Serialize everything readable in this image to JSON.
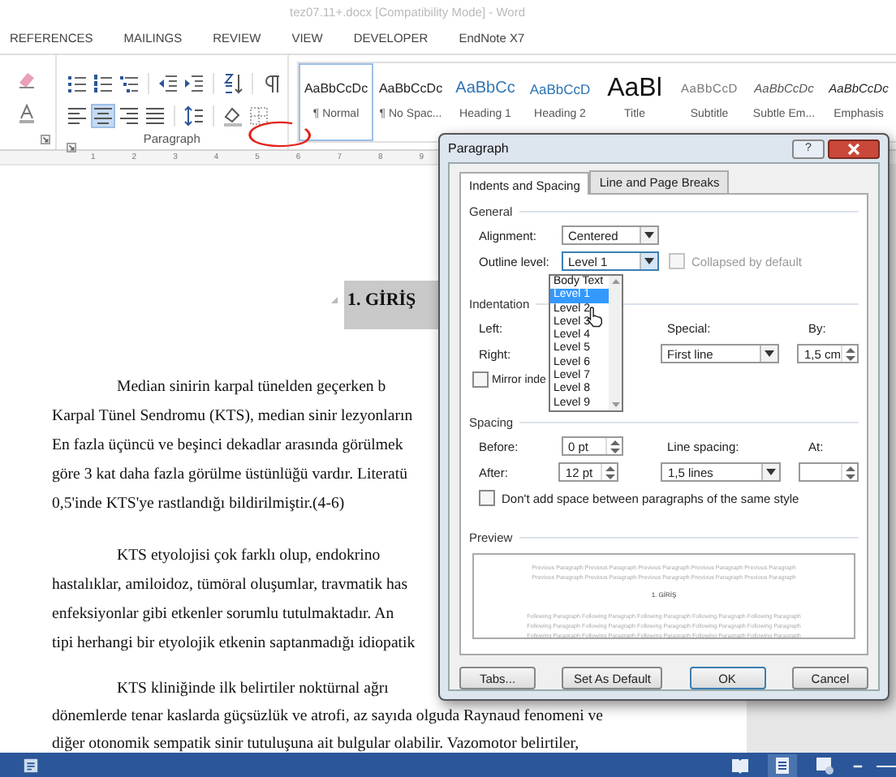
{
  "window": {
    "title": "tez07.11+.docx [Compatibility Mode] - Word"
  },
  "ribbon_tabs": [
    "REFERENCES",
    "MAILINGS",
    "REVIEW",
    "VIEW",
    "DEVELOPER",
    "EndNote X7"
  ],
  "ribbon": {
    "paragraph_group": {
      "label": "Paragraph",
      "alignments": [
        {
          "kind": "left",
          "selected": false
        },
        {
          "kind": "center",
          "selected": true
        },
        {
          "kind": "right",
          "selected": false
        },
        {
          "kind": "justify",
          "selected": false
        }
      ]
    },
    "styles": [
      {
        "kind": "normal",
        "preview": "AaBbCcDc",
        "name": "¶ Normal",
        "selected": true
      },
      {
        "kind": "nospacing",
        "preview": "AaBbCcDc",
        "name": "¶ No Spac...",
        "selected": false
      },
      {
        "kind": "heading1",
        "preview": "AaBbCc",
        "name": "Heading 1",
        "selected": false
      },
      {
        "kind": "heading2",
        "preview": "AaBbCcD",
        "name": "Heading 2",
        "selected": false
      },
      {
        "kind": "title",
        "preview": "AaBl",
        "name": "Title",
        "selected": false
      },
      {
        "kind": "subtitle",
        "preview": "AaBbCcD",
        "name": "Subtitle",
        "selected": false
      },
      {
        "kind": "subtle",
        "preview": "AaBbCcDc",
        "name": "Subtle Em...",
        "selected": false
      },
      {
        "kind": "emphasis",
        "preview": "AaBbCcDc",
        "name": "Emphasis",
        "selected": false
      }
    ]
  },
  "ruler": [
    "1",
    "2",
    "3",
    "4",
    "5",
    "6",
    "7",
    "8",
    "9"
  ],
  "document": {
    "heading": "1. GİRİŞ",
    "paragraphs": [
      {
        "lines": [
          "Median sinirin karpal tünelden geçerken b",
          "Karpal Tünel Sendromu (KTS), median sinir lezyonların",
          "En fazla üçüncü ve beşinci dekadlar arasında görülmek",
          "göre 3 kat daha fazla görülme üstünlüğü vardır. Literatü",
          "0,5'inde KTS'ye rastlandığı bildirilmiştir.(4-6)"
        ]
      },
      {
        "lines": [
          "KTS etyolojisi çok farklı olup, endokrino",
          "hastalıklar, amiloidoz, tümöral oluşumlar, travmatik has",
          "enfeksiyonlar gibi etkenler sorumlu tutulmaktadır.  An",
          "tipi herhangi bir etyolojik etkenin saptanmadığı idiopatik"
        ]
      },
      {
        "lines": [
          "KTS kliniğinde ilk belirtiler noktürnal ağrı",
          "dönemlerde tenar kaslarda güçsüzlük ve atrofi, az sayıda olguda Raynaud fenomeni ve",
          "diğer otonomik sempatik sinir tutuluşuna ait bulgular olabilir. Vazomotor belirtiler,"
        ]
      }
    ]
  },
  "dialog": {
    "title": "Paragraph",
    "help": "?",
    "tabs": [
      {
        "label": "Indents and Spacing",
        "selected": true
      },
      {
        "label": "Line and Page Breaks",
        "selected": false
      }
    ],
    "general": {
      "heading": "General",
      "alignment": {
        "label": "Alignment:",
        "value": "Centered"
      },
      "outline_level": {
        "label": "Outline level:",
        "value": "Level 1"
      },
      "collapsed": {
        "label": "Collapsed by default",
        "checked": false,
        "disabled": true
      },
      "outline_list": [
        {
          "label": "Body Text",
          "selected": false
        },
        {
          "label": "Level 1",
          "selected": true
        },
        {
          "label": "Level 2",
          "selected": false
        },
        {
          "label": "Level 3",
          "selected": false
        },
        {
          "label": "Level 4",
          "selected": false
        },
        {
          "label": "Level 5",
          "selected": false
        },
        {
          "label": "Level 6",
          "selected": false
        },
        {
          "label": "Level 7",
          "selected": false
        },
        {
          "label": "Level 8",
          "selected": false
        },
        {
          "label": "Level 9",
          "selected": false
        }
      ]
    },
    "indentation": {
      "heading": "Indentation",
      "left_label": "Left:",
      "right_label": "Right:",
      "special": {
        "label": "Special:",
        "value": "First line"
      },
      "by": {
        "label": "By:",
        "value": "1,5 cm"
      },
      "mirror": {
        "label": "Mirror inde",
        "checked": false
      }
    },
    "spacing": {
      "heading": "Spacing",
      "before": {
        "label": "Before:",
        "value": "0 pt"
      },
      "after": {
        "label": "After:",
        "value": "12 pt"
      },
      "line_spacing": {
        "label": "Line spacing:",
        "value": "1,5 lines"
      },
      "at": {
        "label": "At:"
      },
      "dont_add": {
        "label": "Don't add space between paragraphs of the same style",
        "checked": false
      }
    },
    "preview": {
      "heading": "Preview",
      "previous_lines": [
        "Previous Paragraph Previous Paragraph Previous Paragraph Previous Paragraph Previous Paragraph",
        "Previous Paragraph Previous Paragraph Previous Paragraph Previous Paragraph Previous Paragraph"
      ],
      "current": "1. GİRİŞ",
      "following_lines": [
        "Following Paragraph Following Paragraph Following Paragraph Following Paragraph Following Paragraph",
        "Following Paragraph Following Paragraph Following Paragraph Following Paragraph Following Paragraph",
        "Following Paragraph Following Paragraph Following Paragraph Following Paragraph Following Paragraph"
      ]
    },
    "buttons": [
      {
        "label": "Tabs...",
        "kind": "normal"
      },
      {
        "label": "Set As Default",
        "kind": "normal"
      },
      {
        "label": "OK",
        "kind": "default"
      },
      {
        "label": "Cancel",
        "kind": "normal"
      }
    ]
  },
  "status_bar": {
    "views": [
      {
        "kind": "read",
        "selected": false
      },
      {
        "kind": "print",
        "selected": true
      },
      {
        "kind": "web",
        "selected": false
      }
    ]
  }
}
